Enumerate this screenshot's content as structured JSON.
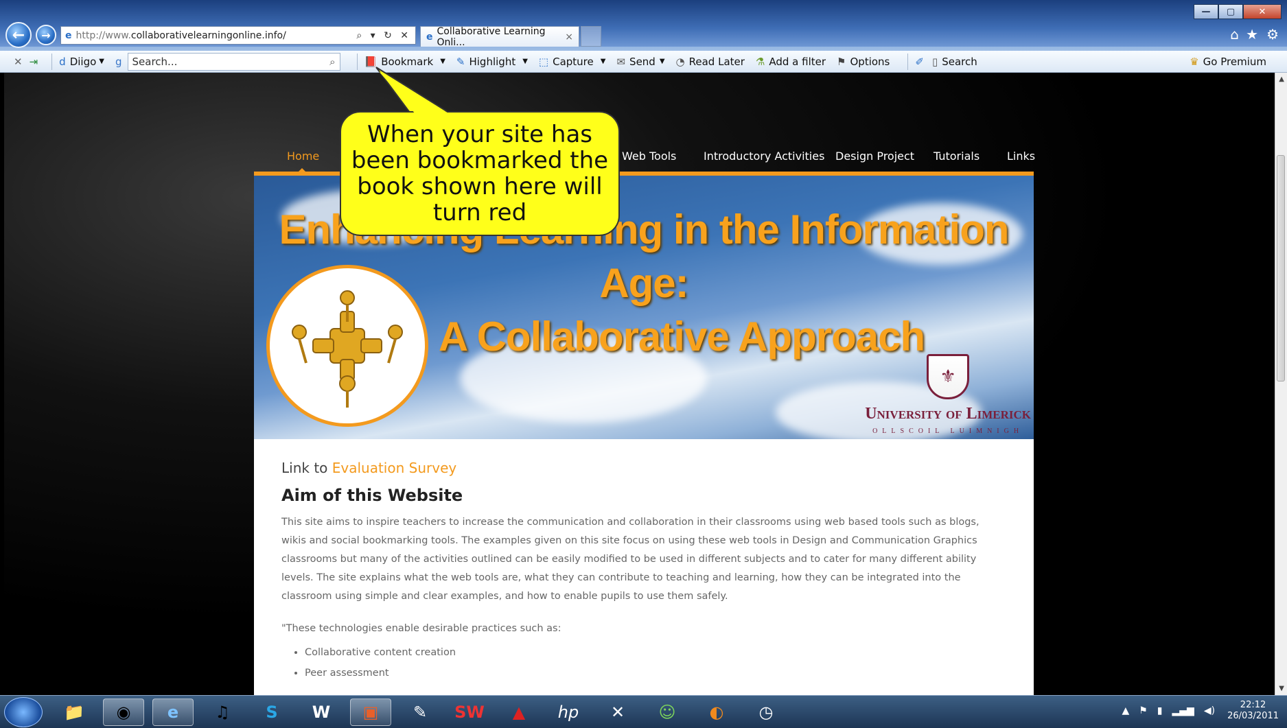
{
  "browser": {
    "address": {
      "prefix": "http://www.",
      "host": "collaborativelearningonline.info/",
      "controls": "⌕ ▾ ↻ ✕"
    },
    "tab": {
      "title": "Collaborative Learning Onli...",
      "close": "×"
    },
    "window_buttons": {
      "minimize": "—",
      "maximize": "▢",
      "close": "✕"
    },
    "toolbar": {
      "diigo_label": "Diigo",
      "search_placeholder": "Search...",
      "bookmark": "Bookmark",
      "highlight": "Highlight",
      "capture": "Capture",
      "send": "Send",
      "read_later": "Read Later",
      "add_filter": "Add a filter",
      "options": "Options",
      "search": "Search",
      "premium": "Go Premium"
    }
  },
  "site": {
    "nav": [
      "Home",
      "Web Tools",
      "Introductory Activities",
      "Design Project",
      "Tutorials",
      "Links"
    ],
    "banner": {
      "title_line1": "Enhancing Learning in the Information Age:",
      "title_line2": "A Collaborative Approach",
      "university": "University of Limerick",
      "university_irish": "OLLSCOIL LUIMNIGH"
    },
    "content": {
      "link_prefix": "Link to ",
      "link_text": "Evaluation Survey",
      "heading": "Aim of this Website",
      "paragraph": "This site aims to inspire teachers to increase the communication and collaboration in their classrooms using web based tools such as blogs, wikis and social bookmarking tools. The examples given on this site focus on using these web tools in Design and Communication Graphics classrooms but many of the activities outlined can be easily modified to be used in different subjects and to cater for many different ability levels. The site explains what the web tools are, what they can contribute to teaching and learning, how they can be integrated into the classroom using simple and clear examples, and how to enable pupils to use them safely.",
      "quote_intro": "\"These technologies enable desirable practices such as:",
      "bullets": [
        "Collaborative content creation",
        "Peer assessment"
      ]
    }
  },
  "callout": {
    "text": "When your site has been bookmarked the book shown here will turn red"
  },
  "taskbar": {
    "apps": [
      "file-explorer-icon",
      "chrome-icon",
      "internet-explorer-icon",
      "itunes-icon",
      "skype-icon",
      "word-icon",
      "presentation-icon",
      "notepad-icon",
      "solidworks-icon",
      "autocad-icon",
      "hp-icon",
      "pdf-icon",
      "messenger-icon",
      "firefox-icon",
      "clock-app-icon"
    ],
    "time": "22:12",
    "date": "26/03/2011"
  }
}
